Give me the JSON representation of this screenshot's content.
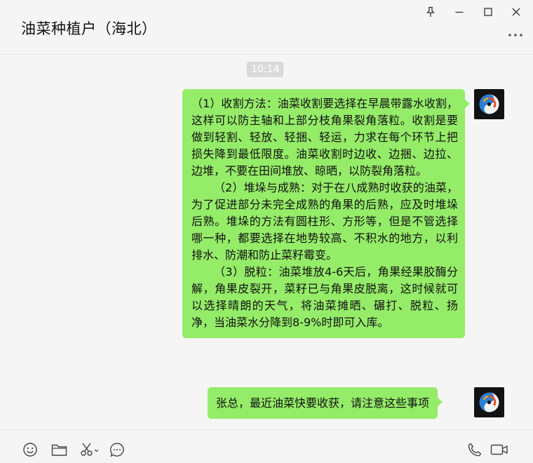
{
  "window": {
    "chat_title": "油菜种植户（海北）",
    "controls": [
      "pin-icon",
      "minimize-icon",
      "maximize-icon",
      "close-icon"
    ]
  },
  "conversation": {
    "timestamp": "10:14",
    "messages": [
      {
        "sender": "self",
        "paragraphs": [
          "（1）收割方法：油菜收割要选择在早晨带露水收割，这样可以防主轴和上部分枝角果裂角落粒。收割是要做到轻割、轻放、轻捆、轻运，力求在每个环节上把损失降到最低限度。油菜收割时边收、边捆、边拉、边堆，不要在田间堆放、晾晒，以防裂角落粒。",
          "（2）堆垛与成熟：对于在八成熟时收获的油菜，为了促进部分未完全成熟的角果的后熟，应及时堆垛后熟。堆垛的方法有圆柱形、方形等，但是不管选择哪一种，都要选择在地势较高、不积水的地方，以利排水、防潮和防止菜籽霉变。",
          "（3）脱粒：油菜堆放4-6天后，角果经果胶酶分解，角果皮裂开，菜籽已与角果皮脱离，这时候就可以选择晴朗的天气，将油菜摊晒、碾打、脱粒、扬净，当油菜水分降到8-9%时即可入库。"
        ]
      },
      {
        "sender": "self",
        "text": "张总，最近油菜快要收获，请注意这些事项"
      }
    ]
  },
  "toolbar": {
    "left_tools": [
      "emoji-icon",
      "folder-icon",
      "scissors-icon",
      "chat-history-icon"
    ],
    "right_tools": [
      "phone-icon",
      "video-icon"
    ]
  },
  "colors": {
    "bubble_self": "#95ec69",
    "background": "#f5f5f5",
    "time_chip": "#dadada"
  }
}
